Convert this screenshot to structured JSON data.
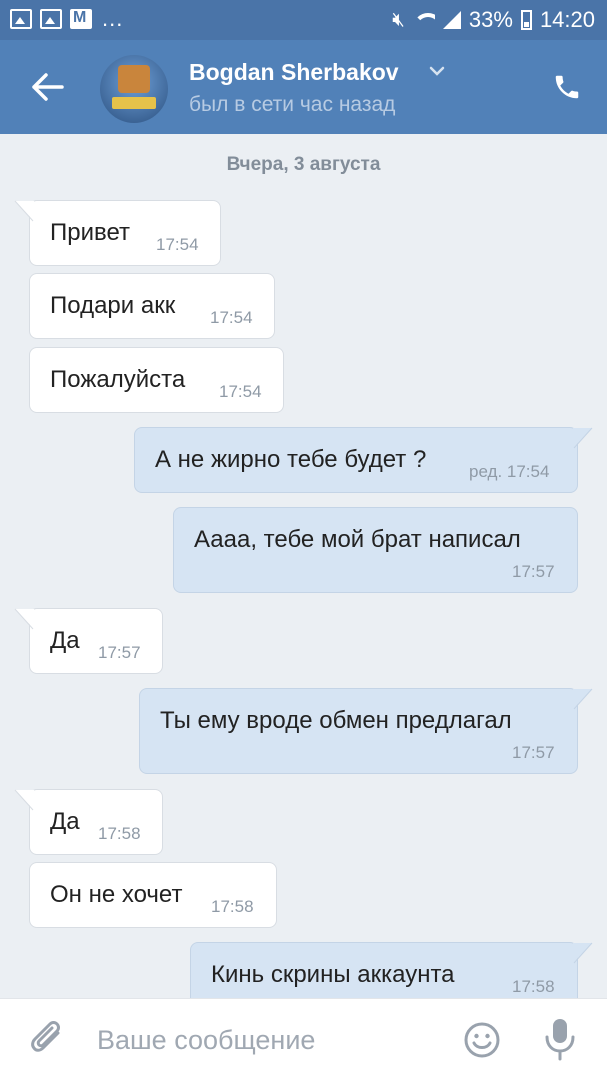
{
  "status_bar": {
    "battery": "33%",
    "time": "14:20",
    "dots": "..."
  },
  "header": {
    "contact_name": "Bogdan Sherbakov",
    "presence": "был в сети час назад"
  },
  "chat": {
    "date_separator": "Вчера, 3 августа",
    "messages": [
      {
        "direction": "in",
        "text": "Привет",
        "time": "17:54"
      },
      {
        "direction": "in",
        "text": "Подари акк",
        "time": "17:54"
      },
      {
        "direction": "in",
        "text": "Пожалуйста",
        "time": "17:54"
      },
      {
        "direction": "out",
        "text": "А не жирно тебе будет ?",
        "time": "ред. 17:54"
      },
      {
        "direction": "out",
        "text": "Аааа, тебе мой брат написал",
        "time": "17:57"
      },
      {
        "direction": "in",
        "text": "Да",
        "time": "17:57"
      },
      {
        "direction": "out",
        "text": "Ты ему вроде обмен предлагал",
        "time": "17:57"
      },
      {
        "direction": "in",
        "text": "Да",
        "time": "17:58"
      },
      {
        "direction": "in",
        "text": "Он не хочет",
        "time": "17:58"
      },
      {
        "direction": "out",
        "text": "Кинь скрины аккаунта",
        "time": "17:58"
      }
    ]
  },
  "composer": {
    "placeholder": "Ваше сообщение"
  },
  "colors": {
    "header_bg": "#5181b8",
    "statusbar_bg": "#4a74a8",
    "chat_bg": "#ebeff3",
    "incoming_bubble": "#ffffff",
    "outgoing_bubble": "#d6e4f3"
  },
  "icons": [
    "gallery-icon",
    "mail-icon",
    "mute-icon",
    "wifi-icon",
    "signal-icon",
    "battery-icon",
    "back-arrow-icon",
    "chevron-down-icon",
    "phone-icon",
    "paperclip-icon",
    "smile-icon",
    "microphone-icon"
  ]
}
